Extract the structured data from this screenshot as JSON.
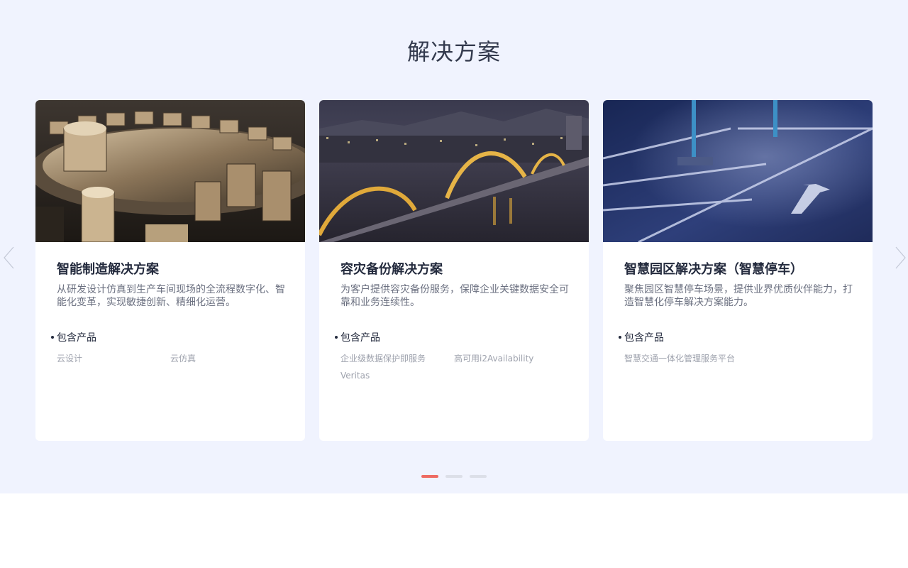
{
  "section": {
    "title": "解决方案"
  },
  "cards": [
    {
      "title": "智能制造解决方案",
      "description": "从研发设计仿真到生产车间现场的全流程数字化、智能化变革，实现敏捷创新、精细化运营。",
      "products_label": "包含产品",
      "products": [
        "云设计",
        "云仿真"
      ],
      "image": "gears-image"
    },
    {
      "title": "容灾备份解决方案",
      "description": "为客户提供容灾备份服务，保障企业关键数据安全可靠和业务连续性。",
      "products_label": "包含产品",
      "products": [
        "企业级数据保护即服务",
        "高可用i2Availability",
        "Veritas"
      ],
      "image": "night-bridge-image"
    },
    {
      "title": "智慧园区解决方案（智慧停车）",
      "description": "聚焦园区智慧停车场景，提供业界优质伙伴能力，打造智慧化停车解决方案能力。",
      "products_label": "包含产品",
      "products": [
        "智慧交通一体化管理服务平台"
      ],
      "image": "parking-lot-image"
    }
  ],
  "carousel": {
    "page_count": 3,
    "active_index": 0,
    "active_color": "#ee6b63",
    "inactive_color": "#dcdfe8"
  },
  "icons": {
    "prev": "chevron-left-icon",
    "next": "chevron-right-icon"
  }
}
